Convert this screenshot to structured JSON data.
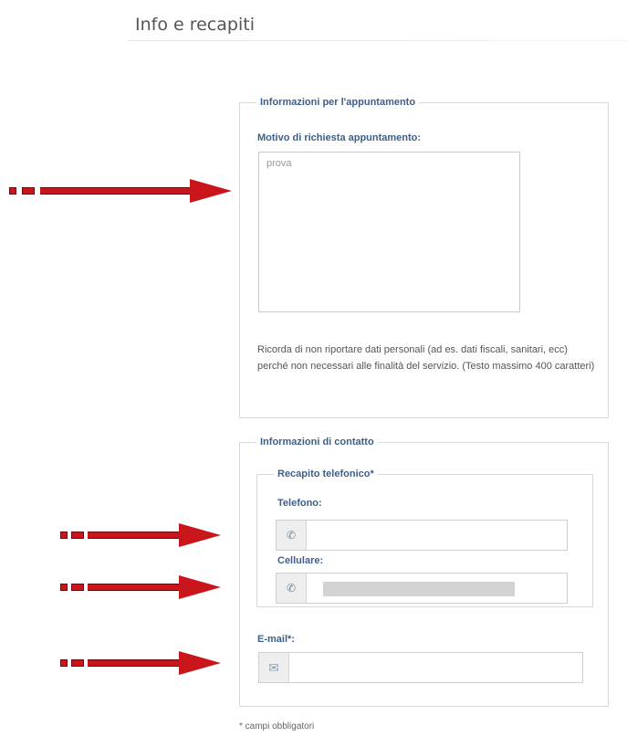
{
  "page": {
    "title": "Info e recapiti"
  },
  "appointment": {
    "legend": "Informazioni per l'appuntamento",
    "reason_label": "Motivo di richiesta appuntamento:",
    "reason_value": "prova",
    "note": "Ricorda di non riportare dati personali (ad es. dati fiscali, sanitari, ecc) perché non necessari alle finalità del servizio. (Testo massimo 400 caratteri)"
  },
  "contact": {
    "legend": "Informazioni di contatto",
    "phone_group": {
      "legend": "Recapito telefonico*",
      "telefono_label": "Telefono:",
      "telefono_value": "",
      "cellulare_label": "Cellulare:"
    },
    "email_label": "E-mail*:",
    "email_value": ""
  },
  "footnote": "* campi obbligatori",
  "icons": {
    "phone": "phone-icon",
    "mail": "envelope-icon"
  },
  "colors": {
    "label_blue": "#3e5f8a",
    "arrow_red": "#c8161c"
  }
}
